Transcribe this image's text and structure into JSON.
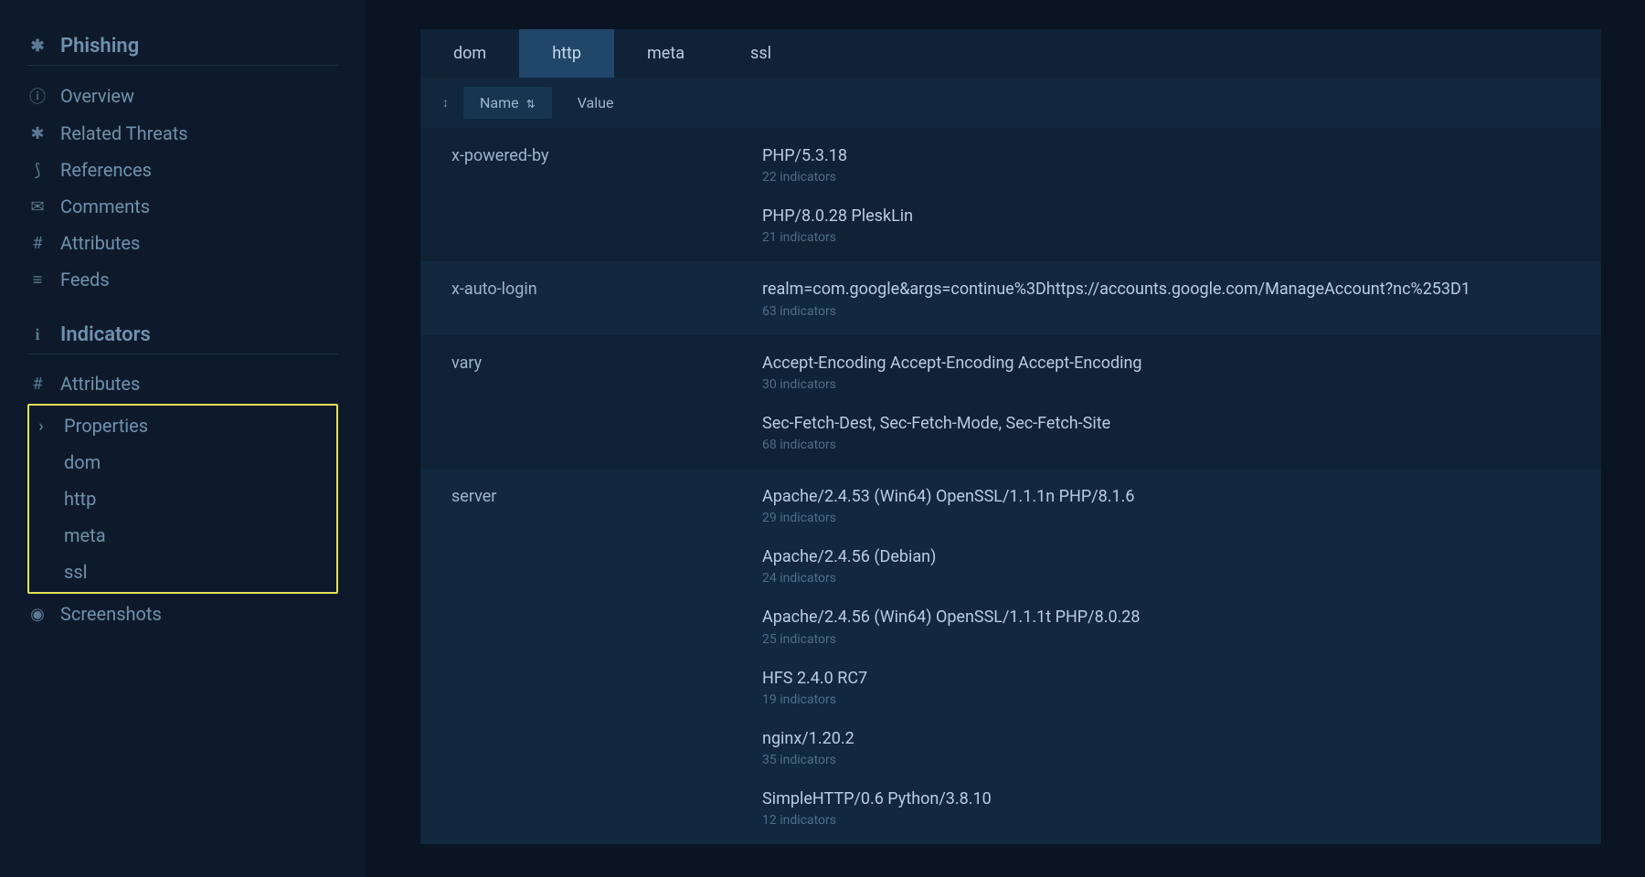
{
  "sidebar": {
    "phishing": {
      "header": "Phishing",
      "items": [
        {
          "label": "Overview"
        },
        {
          "label": "Related Threats"
        },
        {
          "label": "References"
        },
        {
          "label": "Comments"
        },
        {
          "label": "Attributes"
        },
        {
          "label": "Feeds"
        }
      ]
    },
    "indicators": {
      "header": "Indicators",
      "attributes_label": "Attributes",
      "properties_label": "Properties",
      "subitems": [
        {
          "label": "dom"
        },
        {
          "label": "http"
        },
        {
          "label": "meta"
        },
        {
          "label": "ssl"
        }
      ],
      "screenshots_label": "Screenshots"
    }
  },
  "tabs": [
    {
      "label": "dom",
      "active": false
    },
    {
      "label": "http",
      "active": true
    },
    {
      "label": "meta",
      "active": false
    },
    {
      "label": "ssl",
      "active": false
    }
  ],
  "columns": {
    "name": "Name",
    "value": "Value"
  },
  "rows": [
    {
      "name": "x-powered-by",
      "alt": false,
      "values": [
        {
          "text": "PHP/5.3.18",
          "sub": "22 indicators"
        },
        {
          "text": "PHP/8.0.28 PleskLin",
          "sub": "21 indicators"
        }
      ]
    },
    {
      "name": "x-auto-login",
      "alt": true,
      "values": [
        {
          "text": "realm=com.google&args=continue%3Dhttps://accounts.google.com/ManageAccount?nc%253D1",
          "sub": "63 indicators"
        }
      ]
    },
    {
      "name": "vary",
      "alt": false,
      "values": [
        {
          "text": "Accept-Encoding Accept-Encoding Accept-Encoding",
          "sub": "30 indicators"
        },
        {
          "text": "Sec-Fetch-Dest, Sec-Fetch-Mode, Sec-Fetch-Site",
          "sub": "68 indicators"
        }
      ]
    },
    {
      "name": "server",
      "alt": true,
      "values": [
        {
          "text": "Apache/2.4.53 (Win64) OpenSSL/1.1.1n PHP/8.1.6",
          "sub": "29 indicators"
        },
        {
          "text": "Apache/2.4.56 (Debian)",
          "sub": "24 indicators"
        },
        {
          "text": "Apache/2.4.56 (Win64) OpenSSL/1.1.1t PHP/8.0.28",
          "sub": "25 indicators"
        },
        {
          "text": "HFS 2.4.0 RC7",
          "sub": "19 indicators"
        },
        {
          "text": "nginx/1.20.2",
          "sub": "35 indicators"
        },
        {
          "text": "SimpleHTTP/0.6 Python/3.8.10",
          "sub": "12 indicators"
        }
      ]
    }
  ]
}
